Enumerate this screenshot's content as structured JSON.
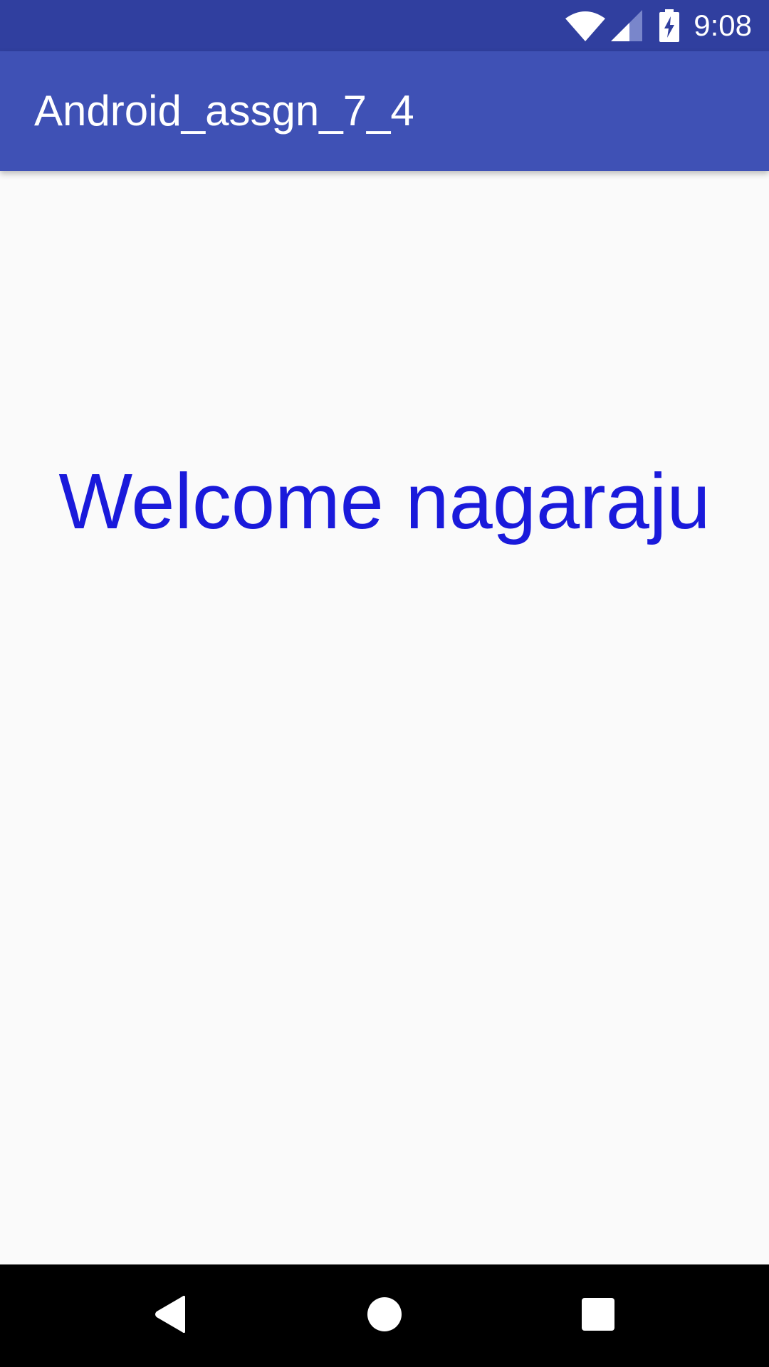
{
  "status_bar": {
    "time": "9:08",
    "icons": [
      "wifi-icon",
      "cell-signal-icon",
      "battery-charging-icon"
    ],
    "color": "#303f9f"
  },
  "app_bar": {
    "title": "Android_assgn_7_4",
    "color": "#3f51b5"
  },
  "main": {
    "welcome_text": "Welcome nagaraju",
    "text_color": "#1a1adb",
    "background": "#fafafa"
  },
  "nav_bar": {
    "buttons": [
      "back-icon",
      "home-icon",
      "recents-icon"
    ],
    "color": "#000000"
  }
}
